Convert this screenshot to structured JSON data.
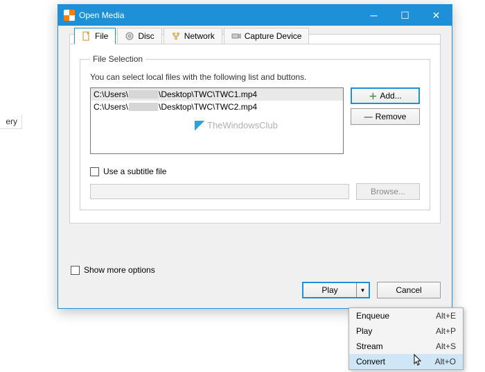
{
  "bg_hint": "ery",
  "window": {
    "title": "Open Media",
    "tabs": {
      "file": "File",
      "disc": "Disc",
      "network": "Network",
      "capture": "Capture Device",
      "active": 0
    },
    "file_selection": {
      "legend": "File Selection",
      "hint": "You can select local files with the following list and buttons.",
      "files": [
        {
          "pre": "C:\\Users\\",
          "post": "\\Desktop\\TWC\\TWC1.mp4",
          "selected": true
        },
        {
          "pre": "C:\\Users\\",
          "post": "\\Desktop\\TWC\\TWC2.mp4",
          "selected": false
        }
      ],
      "add": "Add...",
      "remove": "Remove",
      "watermark": "TheWindowsClub"
    },
    "subtitle": {
      "use_label": "Use a subtitle file",
      "browse": "Browse..."
    },
    "show_more": "Show more options",
    "play": "Play",
    "cancel": "Cancel"
  },
  "dropdown": {
    "items": [
      {
        "label": "Enqueue",
        "shortcut": "Alt+E"
      },
      {
        "label": "Play",
        "shortcut": "Alt+P"
      },
      {
        "label": "Stream",
        "shortcut": "Alt+S"
      },
      {
        "label": "Convert",
        "shortcut": "Alt+O",
        "hover": true
      }
    ]
  }
}
